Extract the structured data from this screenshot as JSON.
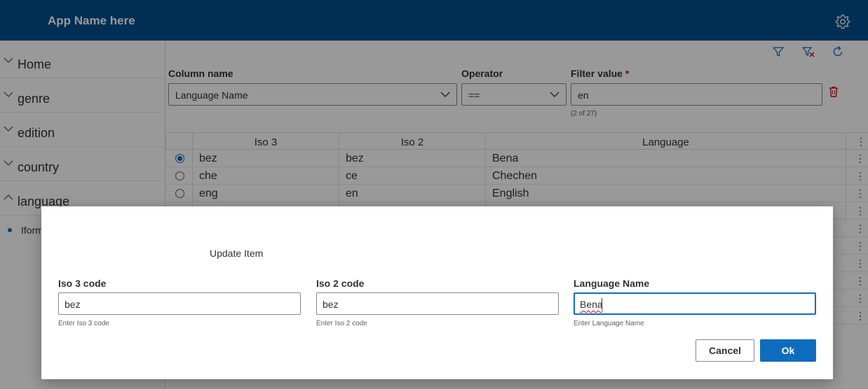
{
  "app": {
    "title": "App Name here"
  },
  "colors": {
    "header": "#004e8c",
    "accent": "#0f6cbd",
    "danger": "#c50f1f"
  },
  "sidebar": {
    "items": [
      {
        "label": "Home",
        "expanded": false
      },
      {
        "label": "genre",
        "expanded": false
      },
      {
        "label": "edition",
        "expanded": false
      },
      {
        "label": "country",
        "expanded": false
      },
      {
        "label": "language",
        "expanded": true
      }
    ],
    "subitem": {
      "label": "Iform"
    }
  },
  "toolbar": {
    "icons": [
      "filter-icon",
      "clear-filter-icon",
      "refresh-icon"
    ]
  },
  "filter": {
    "column_label": "Column name",
    "column_value": "Language Name",
    "operator_label": "Operator",
    "operator_value": "==",
    "value_label": "Filter value",
    "value_required_mark": "*",
    "value": "en",
    "count": "(2 of 27)"
  },
  "grid": {
    "columns": [
      "Iso 3",
      "Iso 2",
      "Language"
    ],
    "rows": [
      {
        "iso3": "bez",
        "iso2": "bez",
        "language": "Bena",
        "selected": true
      },
      {
        "iso3": "che",
        "iso2": "ce",
        "language": "Chechen",
        "selected": false
      },
      {
        "iso3": "eng",
        "iso2": "en",
        "language": "English",
        "selected": false
      }
    ]
  },
  "dialog": {
    "title": "Update Item",
    "fields": [
      {
        "label": "Iso 3 code",
        "value": "bez",
        "hint": "Enter Iso 3 code"
      },
      {
        "label": "Iso 2 code",
        "value": "bez",
        "hint": "Enter Iso 2 code"
      },
      {
        "label": "Language Name",
        "value": "Bena",
        "hint": "Enter Language Name"
      }
    ],
    "cancel_label": "Cancel",
    "ok_label": "Ok"
  }
}
